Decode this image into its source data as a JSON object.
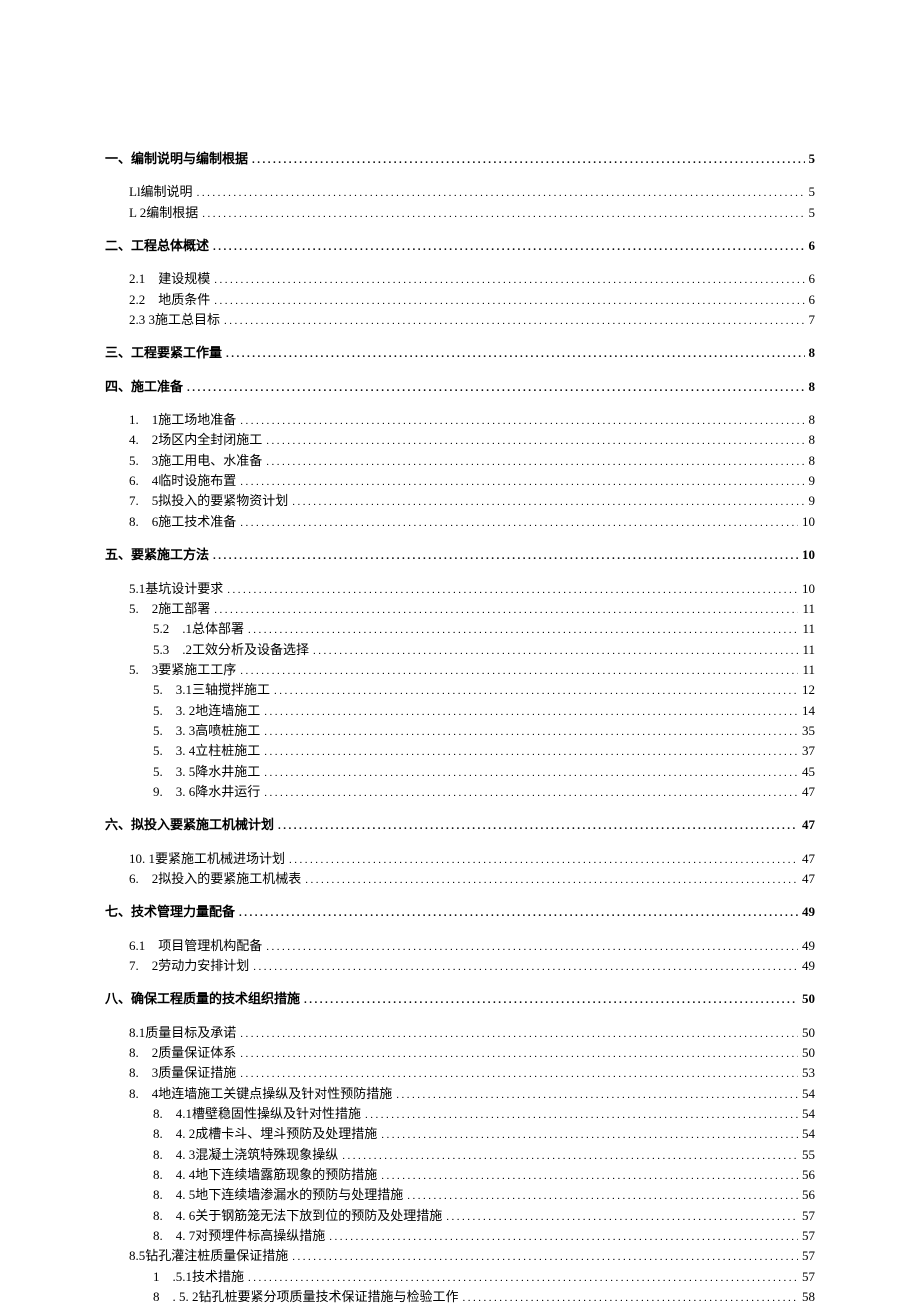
{
  "toc": [
    {
      "label": "一、编制说明与编制根据",
      "page": "5",
      "level": 0,
      "gap_before": false
    },
    {
      "label": "Ll编制说明",
      "page": "5",
      "level": 1,
      "gap_before": true
    },
    {
      "label": "L 2编制根据",
      "page": "5",
      "level": 1,
      "gap_before": false
    },
    {
      "label": "二、工程总体概述",
      "page": "6",
      "level": 0,
      "gap_before": true
    },
    {
      "label": "2.1 建设规模",
      "page": "6",
      "level": 1,
      "gap_before": true
    },
    {
      "label": "2.2 地质条件",
      "page": "6",
      "level": 1,
      "gap_before": false
    },
    {
      "label": "2.3 3施工总目标",
      "page": "7",
      "level": 1,
      "gap_before": false
    },
    {
      "label": "三、工程要紧工作量",
      "page": "8",
      "level": 0,
      "gap_before": true
    },
    {
      "label": "四、施工准备",
      "page": "8",
      "level": 0,
      "gap_before": true
    },
    {
      "label": "1. 1施工场地准备",
      "page": "8",
      "level": 1,
      "gap_before": true
    },
    {
      "label": "4. 2场区内全封闭施工",
      "page": "8",
      "level": 1,
      "gap_before": false
    },
    {
      "label": "5. 3施工用电、水准备",
      "page": "8",
      "level": 1,
      "gap_before": false
    },
    {
      "label": "6. 4临时设施布置",
      "page": "9",
      "level": 1,
      "gap_before": false
    },
    {
      "label": "7. 5拟投入的要紧物资计划",
      "page": " 9",
      "level": 1,
      "gap_before": false
    },
    {
      "label": "8. 6施工技术准备",
      "page": " 10",
      "level": 1,
      "gap_before": false
    },
    {
      "label": "五、要紧施工方法",
      "page": "10",
      "level": 0,
      "gap_before": true
    },
    {
      "label": "5.1基坑设计要求",
      "page": " 10",
      "level": 1,
      "gap_before": true
    },
    {
      "label": "5. 2施工部署",
      "page": "11",
      "level": 1,
      "gap_before": false
    },
    {
      "label": "5.2 .1总体部署",
      "page": "11",
      "level": 2,
      "gap_before": false
    },
    {
      "label": "5.3 .2工效分析及设备选择",
      "page": " 11",
      "level": 2,
      "gap_before": false
    },
    {
      "label": "5. 3要紧施工工序",
      "page": "11",
      "level": 1,
      "gap_before": false
    },
    {
      "label": "5. 3.1三轴搅拌施工",
      "page": "12",
      "level": 2,
      "gap_before": false
    },
    {
      "label": "5. 3. 2地连墙施工",
      "page": "14",
      "level": 2,
      "gap_before": false
    },
    {
      "label": "5. 3. 3高喷桩施工",
      "page": "35",
      "level": 2,
      "gap_before": false
    },
    {
      "label": "5. 3. 4立柱桩施工",
      "page": "37",
      "level": 2,
      "gap_before": false
    },
    {
      "label": "5. 3. 5降水井施工",
      "page": "45",
      "level": 2,
      "gap_before": false
    },
    {
      "label": "9. 3. 6降水井运行",
      "page": "47",
      "level": 2,
      "gap_before": false
    },
    {
      "label": "六、拟投入要紧施工机械计划",
      "page": "47",
      "level": 0,
      "gap_before": true
    },
    {
      "label": "10. 1要紧施工机械进场计划",
      "page": "47",
      "level": 1,
      "gap_before": true
    },
    {
      "label": "6. 2拟投入的要紧施工机械表",
      "page": "47",
      "level": 1,
      "gap_before": false
    },
    {
      "label": "七、技术管理力量配备",
      "page": "49",
      "level": 0,
      "gap_before": true
    },
    {
      "label": "6.1 项目管理机构配备",
      "page": "49",
      "level": 1,
      "gap_before": true
    },
    {
      "label": "7. 2劳动力安排计划",
      "page": "49",
      "level": 1,
      "gap_before": false
    },
    {
      "label": "八、确保工程质量的技术组织措施",
      "page": "50",
      "level": 0,
      "gap_before": true
    },
    {
      "label": "8.1质量目标及承诺",
      "page": "50",
      "level": 1,
      "gap_before": true
    },
    {
      "label": "8. 2质量保证体系",
      "page": "50",
      "level": 1,
      "gap_before": false
    },
    {
      "label": "8. 3质量保证措施",
      "page": "53",
      "level": 1,
      "gap_before": false
    },
    {
      "label": "8. 4地连墙施工关键点操纵及针对性预防措施",
      "page": "54",
      "level": 1,
      "gap_before": false
    },
    {
      "label": "8. 4.1槽壁稳固性操纵及针对性措施",
      "page": "54",
      "level": 3,
      "gap_before": false
    },
    {
      "label": "8. 4. 2成槽卡斗、埋斗预防及处理措施",
      "page": "54",
      "level": 3,
      "gap_before": false
    },
    {
      "label": "8. 4. 3混凝土浇筑特殊现象操纵",
      "page": " 55",
      "level": 3,
      "gap_before": false
    },
    {
      "label": "8. 4. 4地下连续墙露筋现象的预防措施",
      "page": "56",
      "level": 3,
      "gap_before": false
    },
    {
      "label": "8. 4. 5地下连续墙渗漏水的预防与处理措施",
      "page": "56",
      "level": 3,
      "gap_before": false
    },
    {
      "label": "8. 4. 6关于钢筋笼无法下放到位的预防及处理措施",
      "page": "57",
      "level": 3,
      "gap_before": false
    },
    {
      "label": "8. 4. 7对预埋件标高操纵措施",
      "page": "57",
      "level": 3,
      "gap_before": false
    },
    {
      "label": "8.5钻孔灌注桩质量保证措施",
      "page": " 57",
      "level": 1,
      "gap_before": false
    },
    {
      "label": "1 .5.1技术措施",
      "page": "57",
      "level": 3,
      "gap_before": false
    },
    {
      "label": "8 . 5. 2钻孔桩要紧分项质量技术保证措施与检验工作",
      "page": "58",
      "level": 3,
      "gap_before": false
    }
  ]
}
